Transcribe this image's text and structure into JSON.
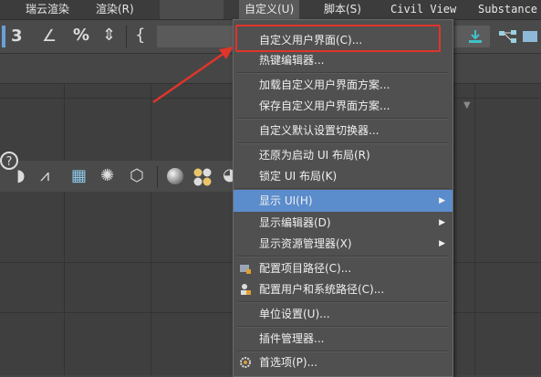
{
  "menubar": {
    "items": [
      {
        "label": "瑞云渲染"
      },
      {
        "label": "渲染(R)"
      },
      {
        "label": "自定义(U)"
      },
      {
        "label": "脚本(S)"
      },
      {
        "label": "Civil View"
      },
      {
        "label": "Substance"
      }
    ]
  },
  "toolbar": {
    "snap_label": "3",
    "percent_label": "%",
    "brace_label": "{"
  },
  "dropdown": {
    "items": [
      {
        "label": "自定义用户界面(C)..."
      },
      {
        "label": "热键编辑器..."
      },
      {
        "label": "加载自定义用户界面方案..."
      },
      {
        "label": "保存自定义用户界面方案..."
      },
      {
        "label": "自定义默认设置切换器..."
      },
      {
        "label": "还原为启动 UI 布局(R)"
      },
      {
        "label": "锁定 UI 布局(K)"
      },
      {
        "label": "显示 UI(H)"
      },
      {
        "label": "显示编辑器(D)"
      },
      {
        "label": "显示资源管理器(X)"
      },
      {
        "label": "配置项目路径(C)..."
      },
      {
        "label": "配置用户和系统路径(C)..."
      },
      {
        "label": "单位设置(U)..."
      },
      {
        "label": "插件管理器..."
      },
      {
        "label": "首选项(P)..."
      }
    ],
    "submenu_arrow": "▶"
  },
  "colors": {
    "highlight": "#5b8ccc",
    "annotation_red": "#e0352b",
    "menu_bg": "#505050"
  }
}
